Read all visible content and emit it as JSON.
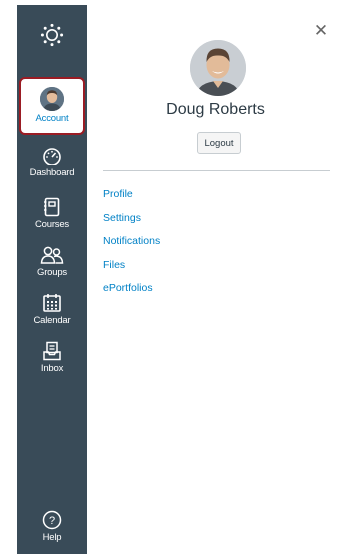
{
  "nav": {
    "logo": {
      "icon": "canvas-logo-icon"
    },
    "account": {
      "label": "Account",
      "icon": "avatar"
    },
    "items": [
      {
        "label": "Dashboard",
        "icon": "dashboard-gauge-icon"
      },
      {
        "label": "Courses",
        "icon": "courses-book-icon"
      },
      {
        "label": "Groups",
        "icon": "groups-people-icon"
      },
      {
        "label": "Calendar",
        "icon": "calendar-icon"
      },
      {
        "label": "Inbox",
        "icon": "inbox-tray-icon"
      }
    ],
    "help": {
      "label": "Help",
      "icon": "help-question-icon"
    }
  },
  "panel": {
    "user_name": "Doug Roberts",
    "logout_label": "Logout",
    "close_icon": "close-icon",
    "links": [
      {
        "label": "Profile"
      },
      {
        "label": "Settings"
      },
      {
        "label": "Notifications"
      },
      {
        "label": "Files"
      },
      {
        "label": "ePortfolios"
      }
    ]
  },
  "colors": {
    "sidebar_bg": "#394b58",
    "accent_red": "#9b1c24",
    "link_blue": "#0081c6",
    "text_dark": "#2d3b45"
  }
}
